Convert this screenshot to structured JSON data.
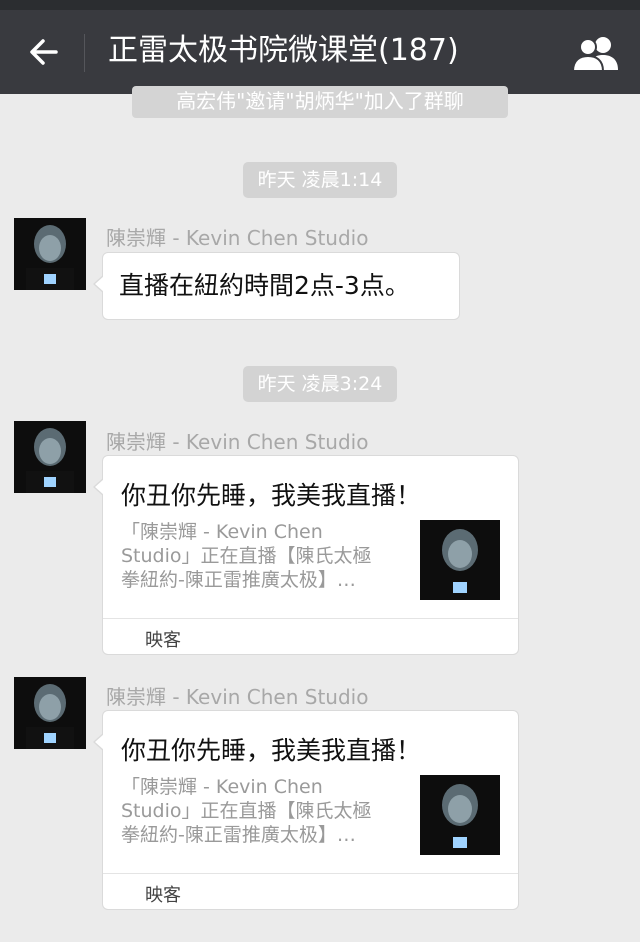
{
  "header": {
    "title": "正雷太极书院微课堂(187)",
    "back_icon": "arrow-left-icon",
    "members_icon": "group-members-icon"
  },
  "chat": {
    "system_notice": "高宏伟\"邀请\"胡炳华\"加入了群聊",
    "messages": [
      {
        "time": "昨天 凌晨1:14",
        "sender": "陳崇輝 - Kevin Chen Studio",
        "text": "直播在紐約時間2点-3点。"
      },
      {
        "time": "昨天 凌晨3:24",
        "sender": "陳崇輝 - Kevin Chen Studio",
        "card": {
          "title": "你丑你先睡，我美我直播！",
          "desc_line1": "「陳崇輝 - Kevin Chen",
          "desc_line2": "Studio」正在直播【陳氏太極",
          "desc_line3": "拳紐約-陳正雷推廣太极】…",
          "source": "映客"
        }
      },
      {
        "sender": "陳崇輝 - Kevin Chen Studio",
        "card": {
          "title": "你丑你先睡，我美我直播！",
          "desc_line1": "「陳崇輝 - Kevin Chen",
          "desc_line2": "Studio」正在直播【陳氏太極",
          "desc_line3": "拳紐約-陳正雷推廣太极】…",
          "source": "映客"
        }
      }
    ]
  },
  "colors": {
    "header_bg": "#393a3f",
    "chat_bg": "#ebebeb",
    "time_bg": "#d3d3d3"
  }
}
